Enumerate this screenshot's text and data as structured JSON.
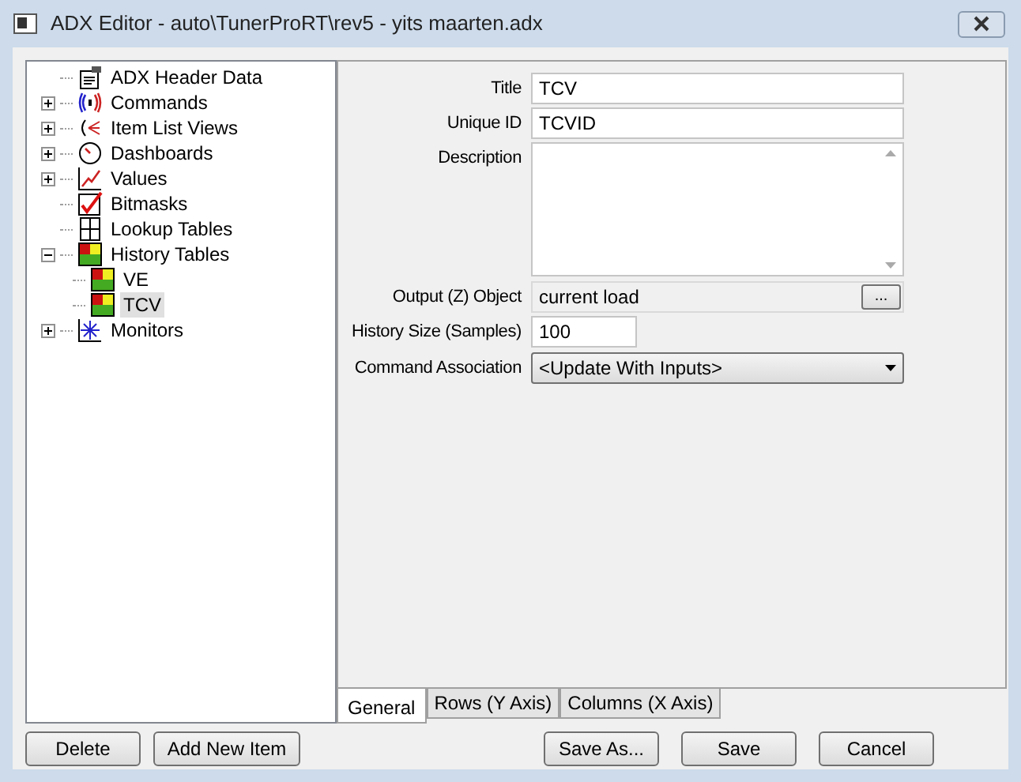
{
  "window": {
    "title": "ADX Editor - auto\\TunerProRT\\rev5 - yits maarten.adx"
  },
  "tree": [
    {
      "label": "ADX Header Data",
      "kind": "header",
      "selected": false
    },
    {
      "label": "Commands",
      "kind": "commands",
      "expanded": false,
      "selected": false
    },
    {
      "label": "Item List Views",
      "kind": "lists",
      "expanded": false,
      "selected": false
    },
    {
      "label": "Dashboards",
      "kind": "gauge",
      "expanded": false,
      "selected": false
    },
    {
      "label": "Values",
      "kind": "values",
      "expanded": false,
      "selected": false
    },
    {
      "label": "Bitmasks",
      "kind": "bitmask",
      "selected": false
    },
    {
      "label": "Lookup Tables",
      "kind": "lookup",
      "selected": false
    },
    {
      "label": "History Tables",
      "kind": "history",
      "expanded": true,
      "selected": false,
      "children": [
        {
          "label": "VE",
          "kind": "history",
          "selected": false
        },
        {
          "label": "TCV",
          "kind": "history",
          "selected": true
        }
      ]
    },
    {
      "label": "Monitors",
      "kind": "monitor",
      "expanded": false,
      "selected": false
    }
  ],
  "form": {
    "title": {
      "label": "Title",
      "value": "TCV"
    },
    "unique_id": {
      "label": "Unique ID",
      "value": "TCVID"
    },
    "description": {
      "label": "Description"
    },
    "output_object": {
      "label": "Output (Z) Object",
      "value": "current load",
      "button": "..."
    },
    "history_size": {
      "label": "History Size (Samples)",
      "value": "100"
    },
    "command_association": {
      "label": "Command Association",
      "value": "<Update With Inputs>"
    }
  },
  "tabs": [
    {
      "label": "General",
      "selected": true
    },
    {
      "label": "Rows (Y Axis)",
      "selected": false
    },
    {
      "label": "Columns (X Axis)",
      "selected": false
    }
  ],
  "buttons_left": [
    "Delete",
    "Add New Item"
  ],
  "buttons_right": [
    "Save As...",
    "Save",
    "Cancel"
  ]
}
